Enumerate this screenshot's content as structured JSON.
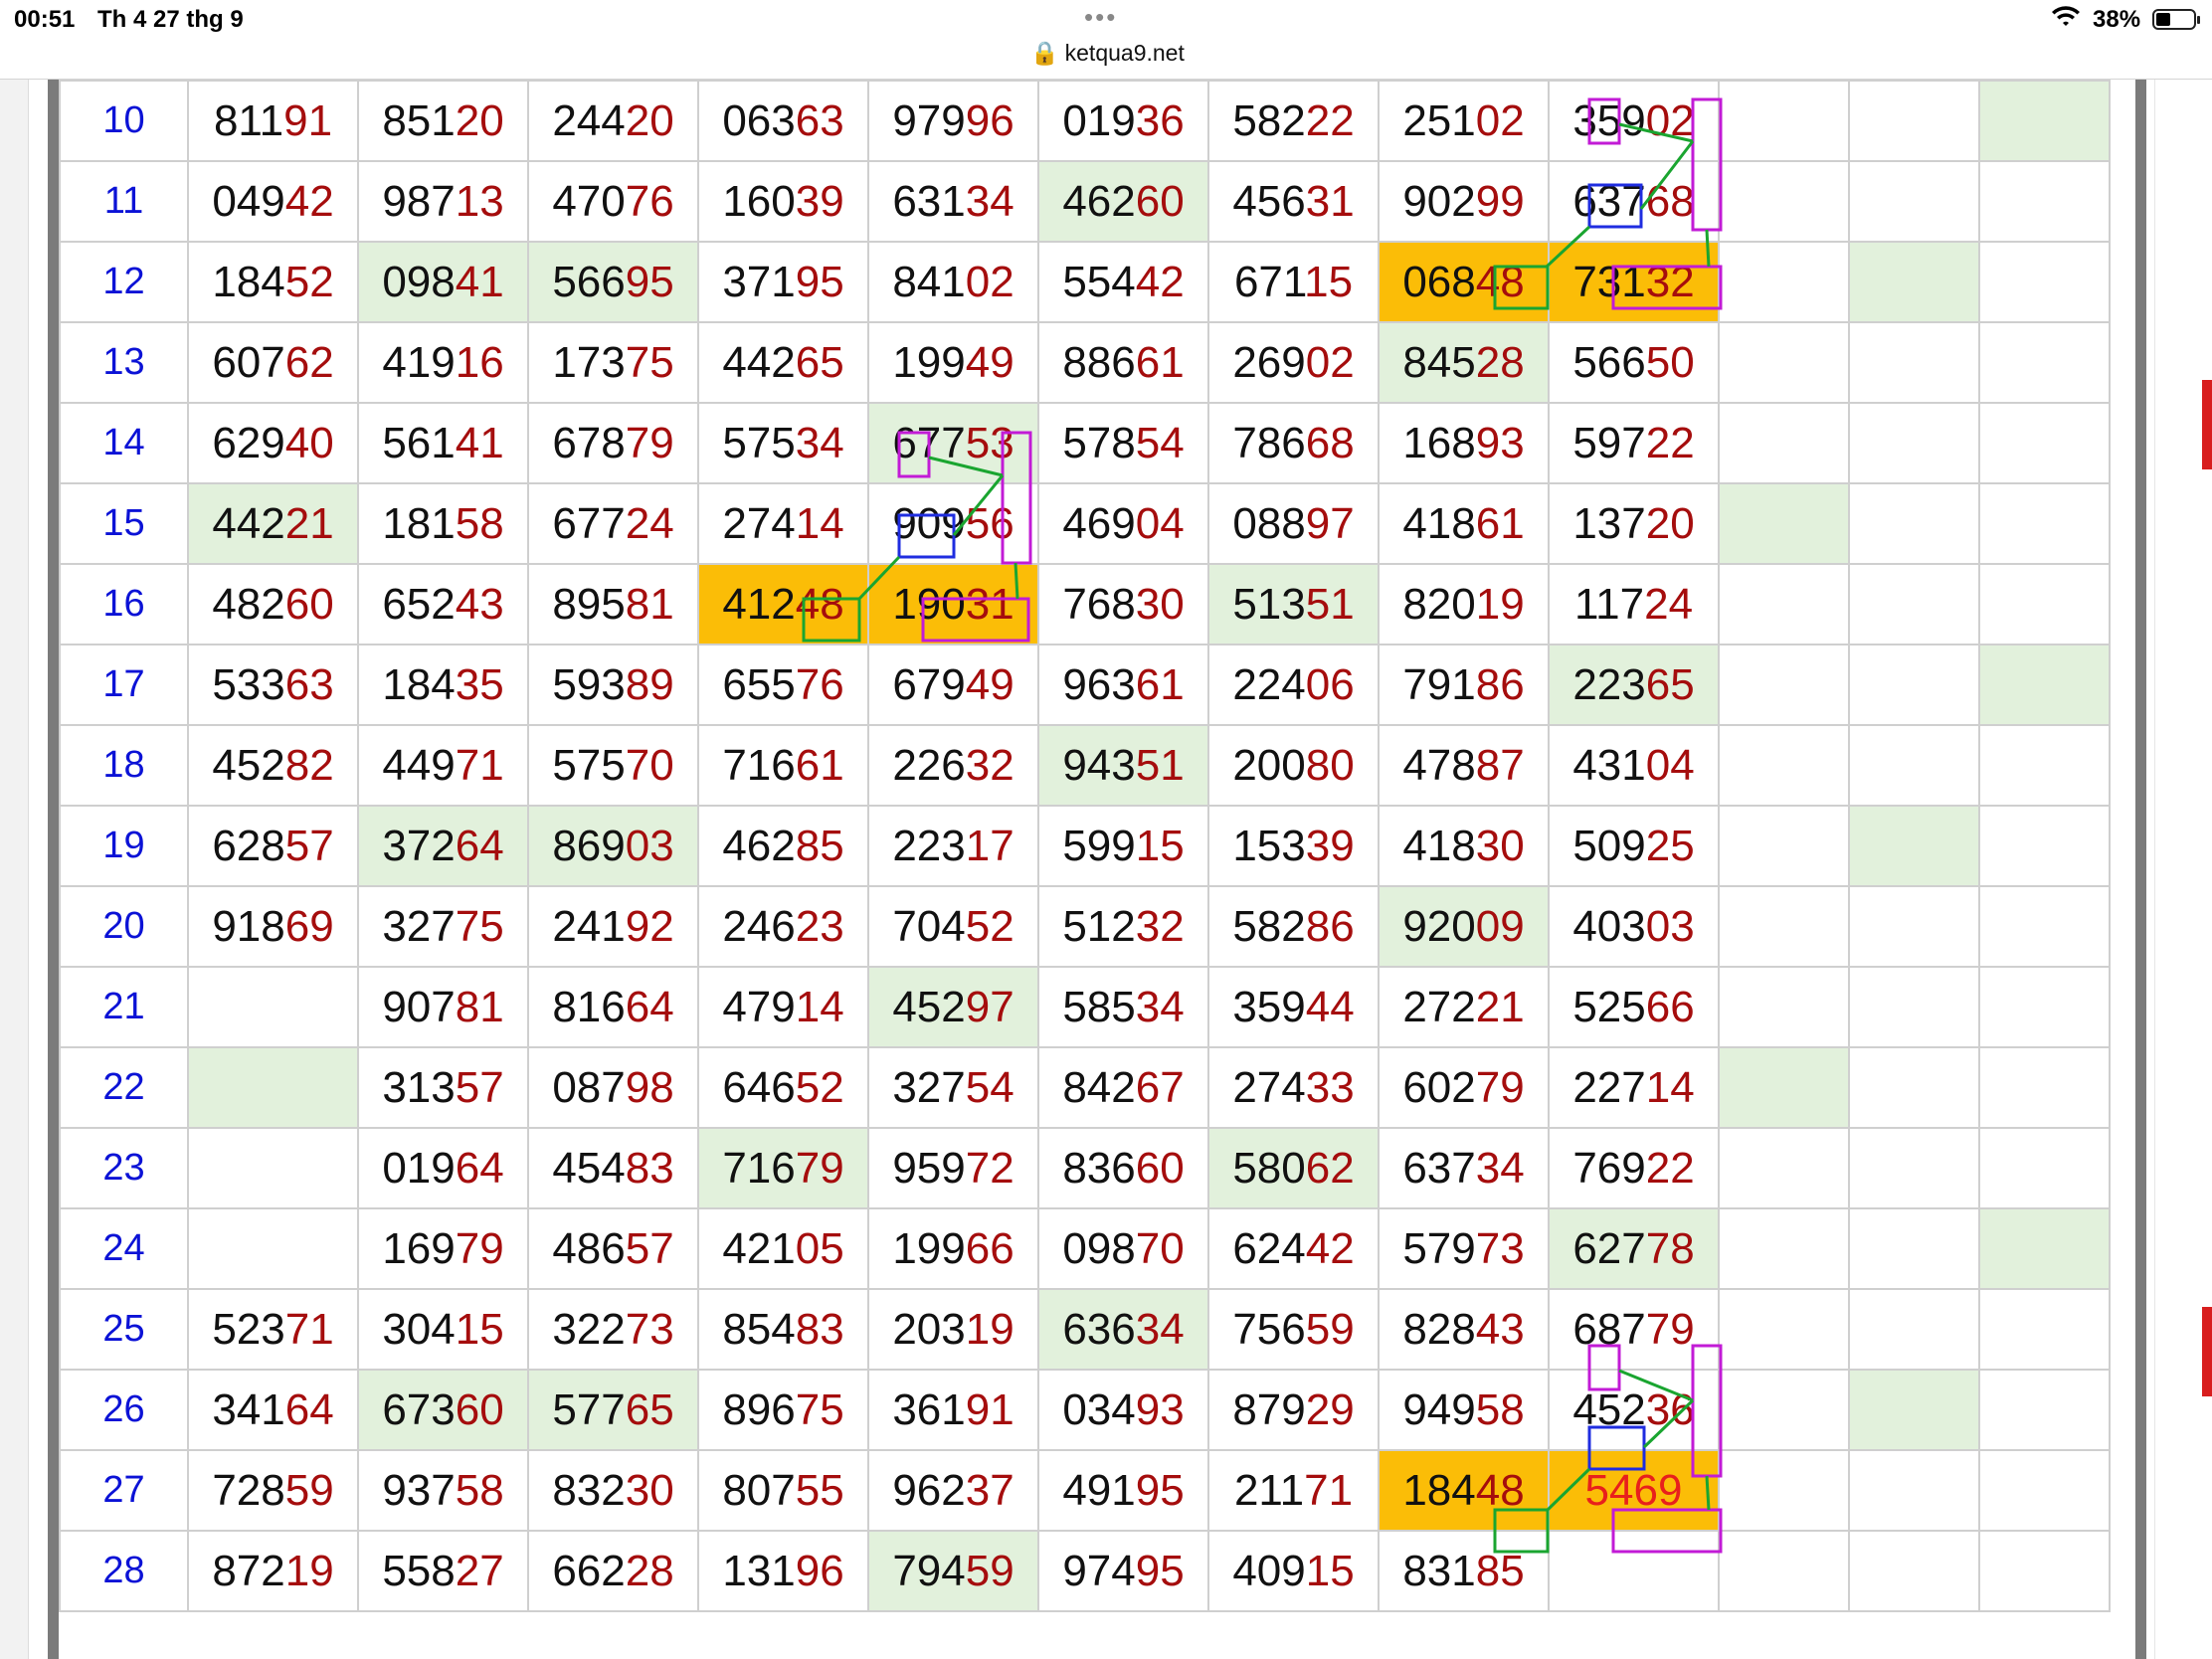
{
  "status_bar": {
    "time": "00:51",
    "date": "Th 4 27 thg 9",
    "url": "ketqua9.net",
    "battery": "38%"
  },
  "table": {
    "rows": [
      {
        "label": "10",
        "cells": [
          {
            "v": "81191"
          },
          {
            "v": "85120"
          },
          {
            "v": "24420"
          },
          {
            "v": "06363"
          },
          {
            "v": "97996"
          },
          {
            "v": "01936"
          },
          {
            "v": "58222"
          },
          {
            "v": "25102"
          },
          {
            "v": "35902"
          }
        ],
        "extra": [
          "",
          "",
          "g"
        ]
      },
      {
        "label": "11",
        "cells": [
          {
            "v": "04942"
          },
          {
            "v": "98713"
          },
          {
            "v": "47076"
          },
          {
            "v": "16039"
          },
          {
            "v": "63134"
          },
          {
            "v": "46260",
            "bg": "g"
          },
          {
            "v": "45631"
          },
          {
            "v": "90299"
          },
          {
            "v": "63768"
          }
        ],
        "extra": [
          "",
          "",
          ""
        ]
      },
      {
        "label": "12",
        "cells": [
          {
            "v": "18452"
          },
          {
            "v": "09841",
            "bg": "g"
          },
          {
            "v": "56695",
            "bg": "g"
          },
          {
            "v": "37195"
          },
          {
            "v": "84102"
          },
          {
            "v": "55442"
          },
          {
            "v": "67115"
          },
          {
            "v": "06848",
            "bg": "o"
          },
          {
            "v": "73132",
            "bg": "o"
          }
        ],
        "extra": [
          "",
          "g",
          ""
        ]
      },
      {
        "label": "13",
        "cells": [
          {
            "v": "60762"
          },
          {
            "v": "41916"
          },
          {
            "v": "17375"
          },
          {
            "v": "44265"
          },
          {
            "v": "19949"
          },
          {
            "v": "88661"
          },
          {
            "v": "26902"
          },
          {
            "v": "84528",
            "bg": "g"
          },
          {
            "v": "56650"
          }
        ],
        "extra": [
          "",
          "",
          ""
        ]
      },
      {
        "label": "14",
        "cells": [
          {
            "v": "62940"
          },
          {
            "v": "56141"
          },
          {
            "v": "67879"
          },
          {
            "v": "57534"
          },
          {
            "v": "67753",
            "bg": "g"
          },
          {
            "v": "57854"
          },
          {
            "v": "78668"
          },
          {
            "v": "16893"
          },
          {
            "v": "59722"
          }
        ],
        "extra": [
          "",
          "",
          ""
        ]
      },
      {
        "label": "15",
        "cells": [
          {
            "v": "44221",
            "bg": "g"
          },
          {
            "v": "18158"
          },
          {
            "v": "67724"
          },
          {
            "v": "27414"
          },
          {
            "v": "90956"
          },
          {
            "v": "46904"
          },
          {
            "v": "08897"
          },
          {
            "v": "41861"
          },
          {
            "v": "13720"
          }
        ],
        "extra": [
          "g",
          "",
          ""
        ]
      },
      {
        "label": "16",
        "cells": [
          {
            "v": "48260"
          },
          {
            "v": "65243"
          },
          {
            "v": "89581"
          },
          {
            "v": "41248",
            "bg": "o"
          },
          {
            "v": "19031",
            "bg": "o"
          },
          {
            "v": "76830"
          },
          {
            "v": "51351",
            "bg": "g"
          },
          {
            "v": "82019"
          },
          {
            "v": "11724"
          }
        ],
        "extra": [
          "",
          "",
          ""
        ]
      },
      {
        "label": "17",
        "cells": [
          {
            "v": "53363"
          },
          {
            "v": "18435"
          },
          {
            "v": "59389"
          },
          {
            "v": "65576"
          },
          {
            "v": "67949"
          },
          {
            "v": "96361"
          },
          {
            "v": "22406"
          },
          {
            "v": "79186"
          },
          {
            "v": "22365",
            "bg": "g"
          }
        ],
        "extra": [
          "",
          "",
          "g"
        ]
      },
      {
        "label": "18",
        "cells": [
          {
            "v": "45282"
          },
          {
            "v": "44971"
          },
          {
            "v": "57570"
          },
          {
            "v": "71661"
          },
          {
            "v": "22632"
          },
          {
            "v": "94351",
            "bg": "g"
          },
          {
            "v": "20080"
          },
          {
            "v": "47887"
          },
          {
            "v": "43104"
          }
        ],
        "extra": [
          "",
          "",
          ""
        ]
      },
      {
        "label": "19",
        "cells": [
          {
            "v": "62857"
          },
          {
            "v": "37264",
            "bg": "g"
          },
          {
            "v": "86903",
            "bg": "g"
          },
          {
            "v": "46285"
          },
          {
            "v": "22317"
          },
          {
            "v": "59915"
          },
          {
            "v": "15339"
          },
          {
            "v": "41830"
          },
          {
            "v": "50925"
          }
        ],
        "extra": [
          "",
          "g",
          ""
        ]
      },
      {
        "label": "20",
        "cells": [
          {
            "v": "91869"
          },
          {
            "v": "32775"
          },
          {
            "v": "24192"
          },
          {
            "v": "24623"
          },
          {
            "v": "70452"
          },
          {
            "v": "51232"
          },
          {
            "v": "58286"
          },
          {
            "v": "92009",
            "bg": "g"
          },
          {
            "v": "40303"
          }
        ],
        "extra": [
          "",
          "",
          ""
        ]
      },
      {
        "label": "21",
        "cells": [
          {
            "v": ""
          },
          {
            "v": "90781"
          },
          {
            "v": "81664"
          },
          {
            "v": "47914"
          },
          {
            "v": "45297",
            "bg": "g"
          },
          {
            "v": "58534"
          },
          {
            "v": "35944"
          },
          {
            "v": "27221"
          },
          {
            "v": "52566"
          }
        ],
        "extra": [
          "",
          "",
          ""
        ]
      },
      {
        "label": "22",
        "cells": [
          {
            "v": "",
            "bg": "g"
          },
          {
            "v": "31357"
          },
          {
            "v": "08798"
          },
          {
            "v": "64652"
          },
          {
            "v": "32754"
          },
          {
            "v": "84267"
          },
          {
            "v": "27433"
          },
          {
            "v": "60279"
          },
          {
            "v": "22714"
          }
        ],
        "extra": [
          "g",
          "",
          ""
        ]
      },
      {
        "label": "23",
        "cells": [
          {
            "v": ""
          },
          {
            "v": "01964"
          },
          {
            "v": "45483"
          },
          {
            "v": "71679",
            "bg": "g"
          },
          {
            "v": "95972"
          },
          {
            "v": "83660"
          },
          {
            "v": "58062",
            "bg": "g"
          },
          {
            "v": "63734"
          },
          {
            "v": "76922"
          }
        ],
        "extra": [
          "",
          "",
          ""
        ]
      },
      {
        "label": "24",
        "cells": [
          {
            "v": ""
          },
          {
            "v": "16979"
          },
          {
            "v": "48657"
          },
          {
            "v": "42105"
          },
          {
            "v": "19966"
          },
          {
            "v": "09870"
          },
          {
            "v": "62442"
          },
          {
            "v": "57973"
          },
          {
            "v": "62778",
            "bg": "g"
          }
        ],
        "extra": [
          "",
          "",
          "g"
        ]
      },
      {
        "label": "25",
        "cells": [
          {
            "v": "52371"
          },
          {
            "v": "30415"
          },
          {
            "v": "32273"
          },
          {
            "v": "85483"
          },
          {
            "v": "20319"
          },
          {
            "v": "63634",
            "bg": "g"
          },
          {
            "v": "75659"
          },
          {
            "v": "82843"
          },
          {
            "v": "68779"
          }
        ],
        "extra": [
          "",
          "",
          ""
        ]
      },
      {
        "label": "26",
        "cells": [
          {
            "v": "34164"
          },
          {
            "v": "67360",
            "bg": "g"
          },
          {
            "v": "57765",
            "bg": "g"
          },
          {
            "v": "89675"
          },
          {
            "v": "36191"
          },
          {
            "v": "03493"
          },
          {
            "v": "87929"
          },
          {
            "v": "94958"
          },
          {
            "v": "45236"
          }
        ],
        "extra": [
          "",
          "g",
          ""
        ]
      },
      {
        "label": "27",
        "cells": [
          {
            "v": "72859"
          },
          {
            "v": "93758"
          },
          {
            "v": "83230"
          },
          {
            "v": "80755"
          },
          {
            "v": "96237"
          },
          {
            "v": "49195"
          },
          {
            "v": "21171"
          },
          {
            "v": "18448",
            "bg": "o"
          },
          {
            "v": "5469",
            "bg": "o",
            "hl": true
          }
        ],
        "extra": [
          "",
          "",
          ""
        ]
      },
      {
        "label": "28",
        "cells": [
          {
            "v": "87219"
          },
          {
            "v": "55827"
          },
          {
            "v": "66228"
          },
          {
            "v": "13196"
          },
          {
            "v": "79459",
            "bg": "g"
          },
          {
            "v": "97495"
          },
          {
            "v": "40915"
          },
          {
            "v": "83185"
          },
          {
            "v": ""
          }
        ],
        "extra": [
          "",
          "",
          ""
        ]
      }
    ]
  },
  "colors": {
    "index_blue": "#0b12d6",
    "tail_red": "#a50d0d",
    "green_cell": "#e2f1dc",
    "orange_cell": "#fbbd07",
    "magenta_box": "#c21bd6",
    "blue_box": "#1f2de0",
    "green_line": "#1aa530"
  }
}
